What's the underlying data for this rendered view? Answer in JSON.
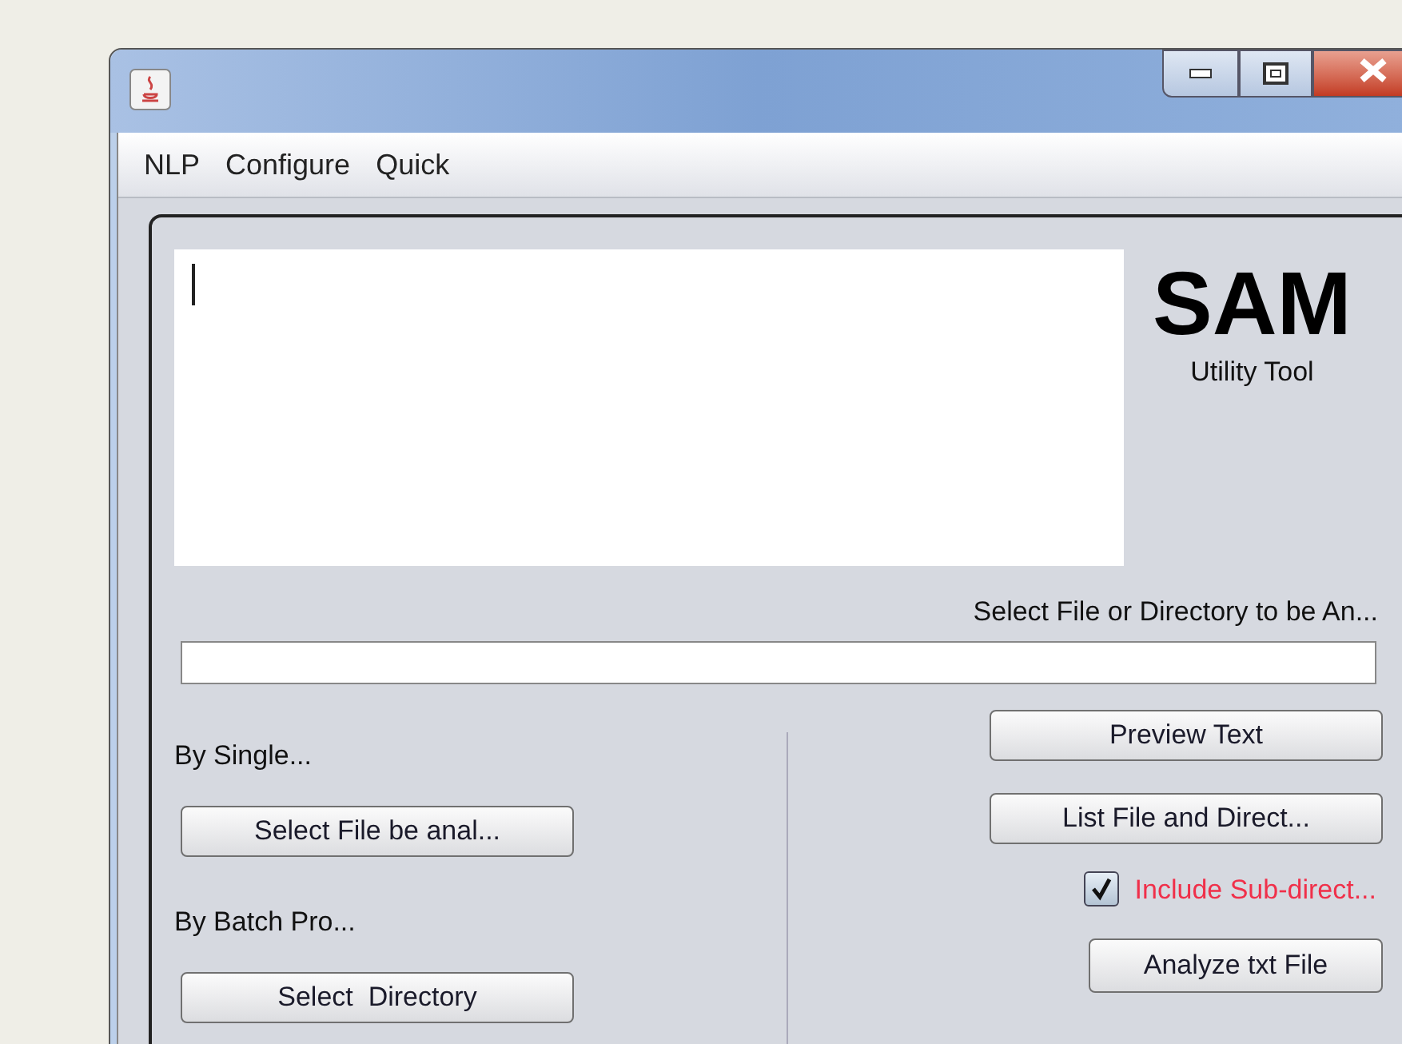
{
  "menu": [
    "NLP",
    "Configure",
    "Quick"
  ],
  "logo": {
    "title": "SAM",
    "subtitle": "Utility Tool"
  },
  "path": {
    "label": "Select File or Directory to be An..."
  },
  "left": [
    {
      "label": "By Single...",
      "button": "Select File be anal..."
    },
    {
      "label": "By Batch Pro...",
      "button": "Select  Directory"
    }
  ],
  "right": [
    {
      "kind": "button",
      "label": "Preview Text"
    },
    {
      "kind": "button",
      "label": "List File and Direct..."
    },
    {
      "kind": "checkbox",
      "label": "Include Sub-direct...",
      "checked": true
    },
    {
      "kind": "compact_button",
      "label": "Analyze txt File"
    }
  ]
}
